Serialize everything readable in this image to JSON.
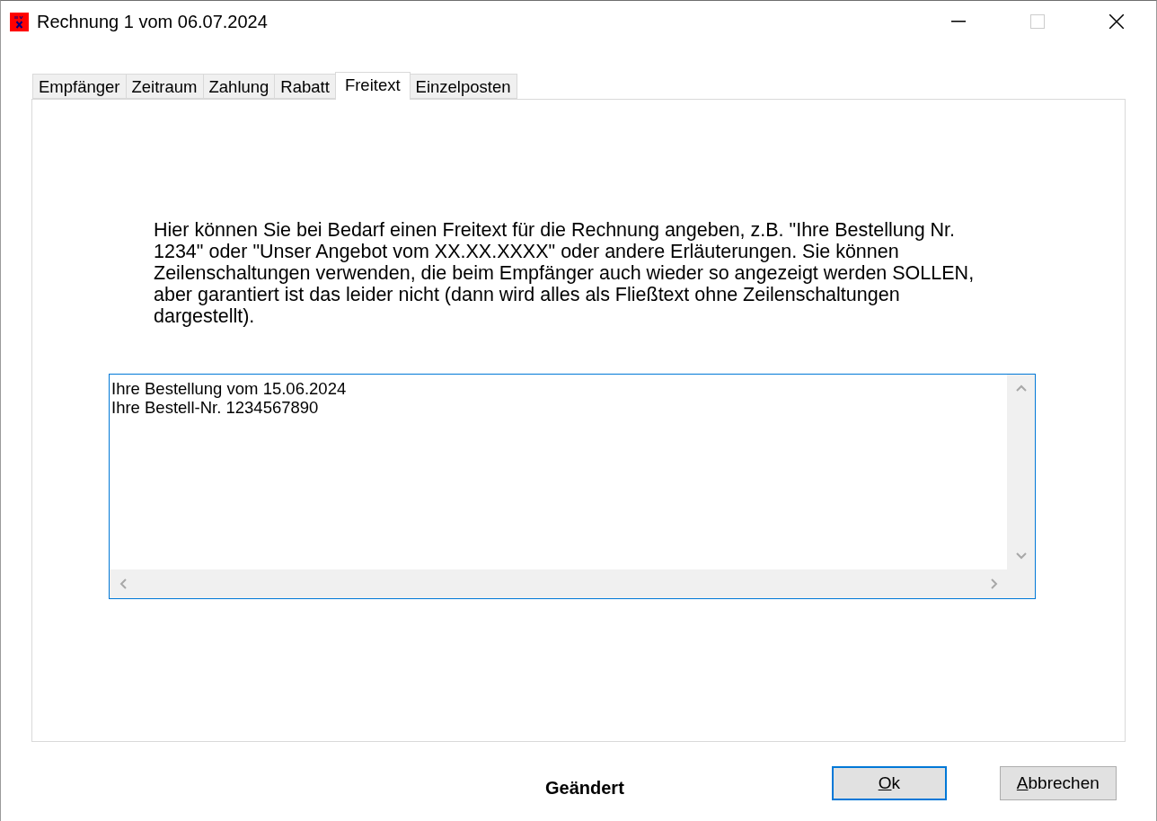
{
  "window": {
    "title": "Rechnung 1 vom 06.07.2024",
    "maximize_disabled": true
  },
  "tabs": [
    {
      "label": "Empfänger",
      "selected": false
    },
    {
      "label": "Zeitraum",
      "selected": false
    },
    {
      "label": "Zahlung",
      "selected": false
    },
    {
      "label": "Rabatt",
      "selected": false
    },
    {
      "label": "Freitext",
      "selected": true
    },
    {
      "label": "Einzelposten",
      "selected": false
    }
  ],
  "description": "Hier können Sie bei Bedarf einen Freitext für die Rechnung angeben, z.B. \"Ihre Bestellung Nr. 1234\" oder \"Unser Angebot vom XX.XX.XXXX\" oder andere Erläuterungen. Sie können Zeilenschaltungen verwenden, die beim Empfänger auch wieder so angezeigt werden SOLLEN, aber garantiert ist das leider nicht (dann wird alles als Fließtext ohne Zeilenschaltungen dargestellt).",
  "freetext": {
    "lines": [
      "Ihre Bestellung vom 15.06.2024",
      "Ihre Bestell-Nr. 1234567890"
    ],
    "focused": true
  },
  "status": "Geändert",
  "buttons": [
    {
      "label": "Ok",
      "default": true
    },
    {
      "label": "Abbrechen",
      "default": false
    }
  ]
}
